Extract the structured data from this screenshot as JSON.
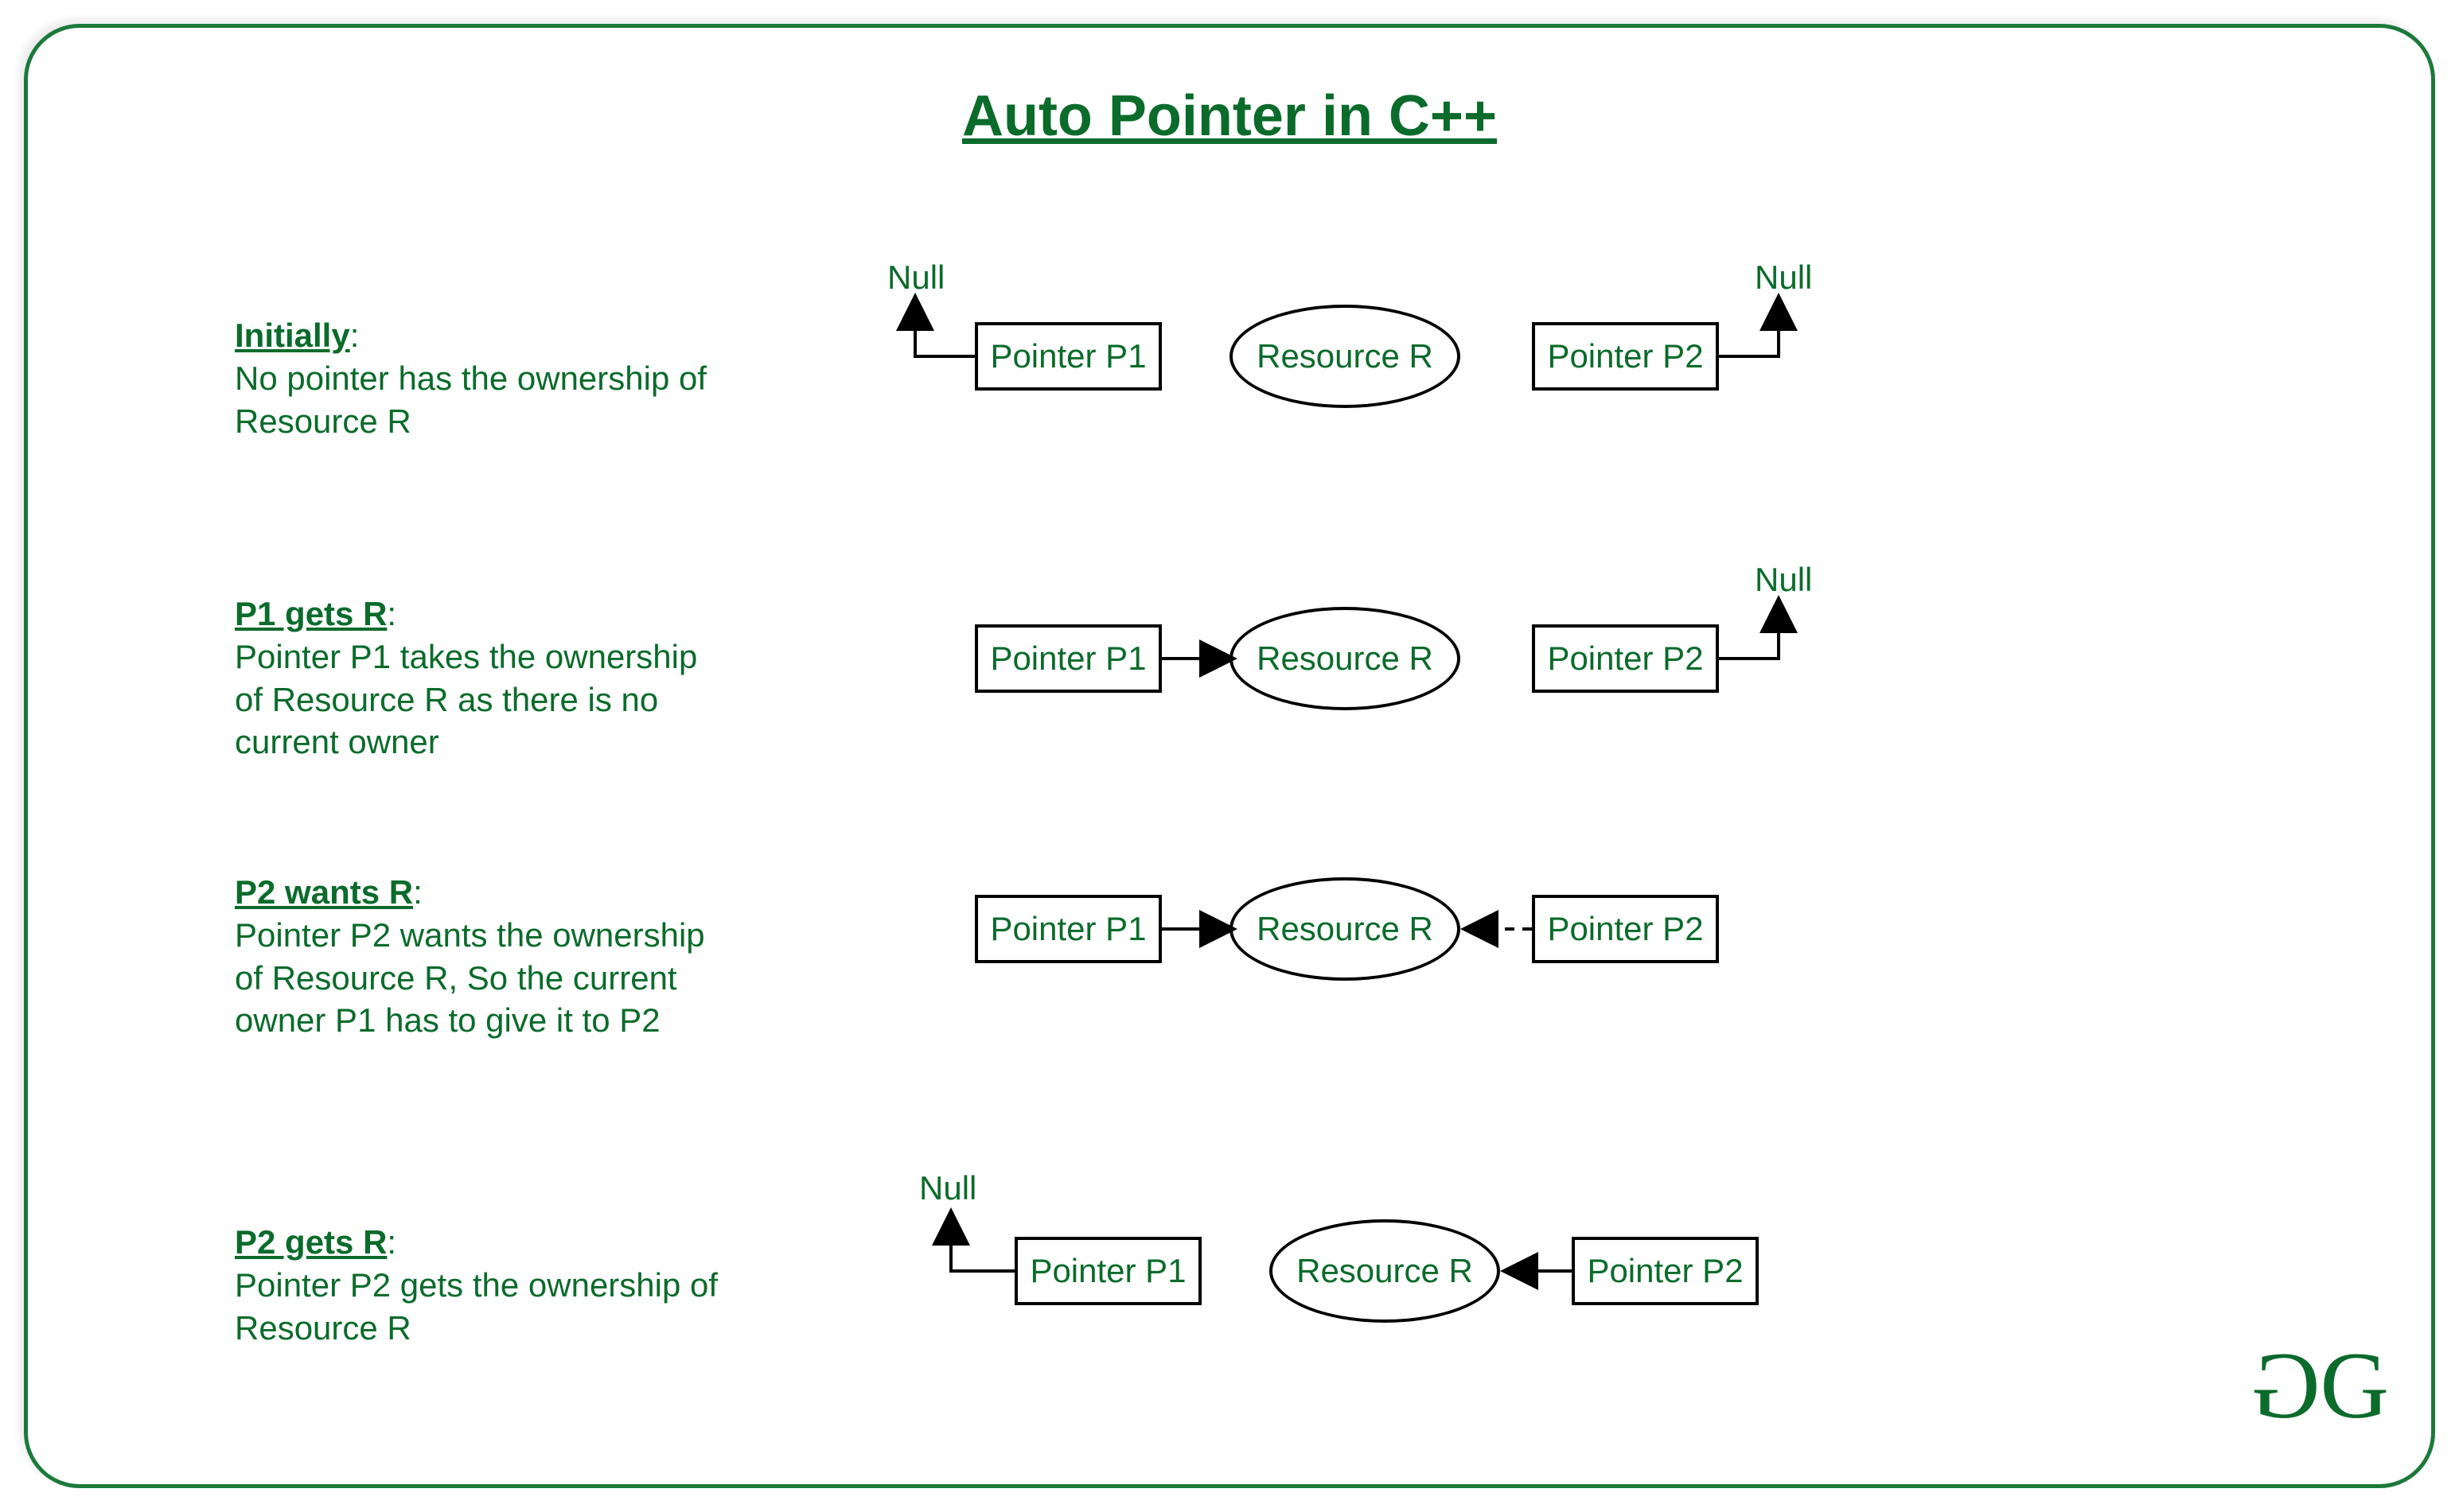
{
  "title": "Auto Pointer in C++",
  "labels": {
    "p1": "Pointer P1",
    "p2": "Pointer P2",
    "resource": "Resource R",
    "null": "Null"
  },
  "steps": [
    {
      "heading": "Initially",
      "body": "No pointer has the ownership of Resource R",
      "p1_null": true,
      "p2_null": true,
      "p1_to_r": false,
      "p2_to_r": false,
      "p2_to_r_dashed": false
    },
    {
      "heading": "P1 gets R",
      "body": "Pointer P1 takes the ownership of Resource R as there is no current owner",
      "p1_null": false,
      "p2_null": true,
      "p1_to_r": true,
      "p2_to_r": false,
      "p2_to_r_dashed": false
    },
    {
      "heading": "P2 wants R",
      "body": "Pointer P2 wants the ownership of Resource R, So the current owner P1 has to give it to P2",
      "p1_null": false,
      "p2_null": false,
      "p1_to_r": true,
      "p2_to_r": false,
      "p2_to_r_dashed": true
    },
    {
      "heading": "P2 gets R",
      "body": "Pointer P2 gets the ownership of Resource R",
      "p1_null": true,
      "p2_null": false,
      "p1_to_r": false,
      "p2_to_r": true,
      "p2_to_r_dashed": false
    }
  ],
  "colors": {
    "green": "#0b6b2b",
    "border": "#1b7a3a"
  }
}
